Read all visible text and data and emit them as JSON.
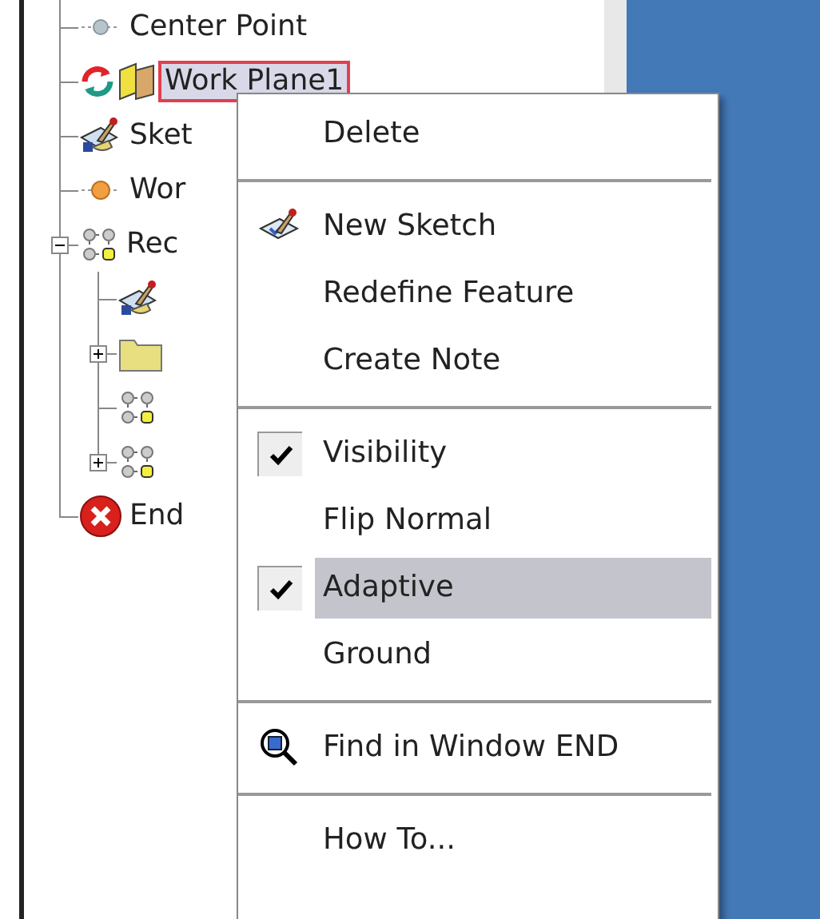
{
  "tree": [
    {
      "label": "Center Point",
      "kind": "point",
      "selected": false
    },
    {
      "label": "Work Plane1",
      "kind": "work_plane",
      "selected": true
    },
    {
      "label": "Sket",
      "kind": "sketch",
      "selected": false
    },
    {
      "label": "Wor",
      "kind": "work_point",
      "selected": false
    },
    {
      "label": "Rec",
      "kind": "pattern",
      "selected": false,
      "expanded": true,
      "children": [
        {
          "kind": "sketch",
          "selected": false
        },
        {
          "kind": "folder",
          "selected": false,
          "expanded": false
        },
        {
          "kind": "pattern",
          "selected": false
        },
        {
          "kind": "pattern",
          "selected": false,
          "expanded": false
        }
      ]
    },
    {
      "label": "End",
      "kind": "end",
      "selected": false
    }
  ],
  "context_menu": [
    {
      "kind": "item",
      "label": "Delete",
      "selected": false
    },
    {
      "kind": "separator"
    },
    {
      "kind": "sketch_item",
      "label": "New Sketch",
      "selected": false
    },
    {
      "kind": "item",
      "label": "Redefine Feature",
      "selected": false
    },
    {
      "kind": "item",
      "label": "Create Note",
      "selected": false
    },
    {
      "kind": "separator"
    },
    {
      "kind": "item",
      "label": "Visibility",
      "checked": true,
      "selected": false
    },
    {
      "kind": "item",
      "label": "Flip Normal",
      "selected": false
    },
    {
      "kind": "item",
      "label": "Adaptive",
      "checked": true,
      "selected": true
    },
    {
      "kind": "item",
      "label": "Ground",
      "selected": false
    },
    {
      "kind": "separator"
    },
    {
      "kind": "find_item",
      "label": "Find in Window END",
      "selected": false
    },
    {
      "kind": "separator"
    },
    {
      "kind": "item",
      "label": "How To...",
      "selected": false
    }
  ]
}
